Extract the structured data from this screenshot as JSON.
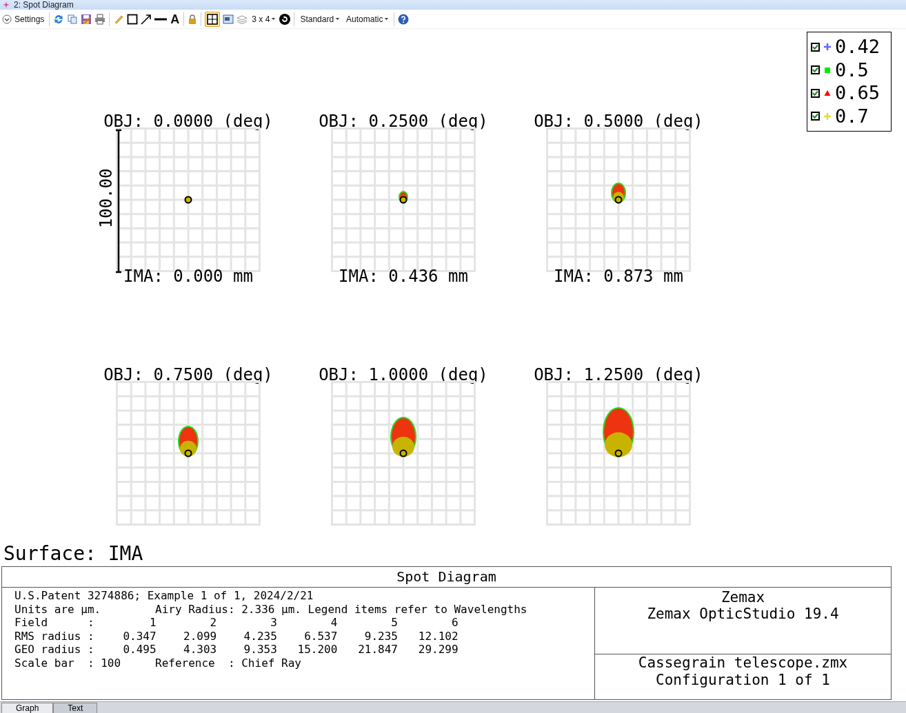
{
  "window": {
    "title": "2: Spot Diagram"
  },
  "toolbar": {
    "settings_label": "Settings",
    "text_tool": "A",
    "layout_selected": true,
    "grid_menu": "3 x 4",
    "standard_menu": "Standard",
    "automatic_menu": "Automatic"
  },
  "legend": [
    {
      "label": "0.42",
      "checked": true,
      "kind": "plus",
      "color": "#6666ff"
    },
    {
      "label": "0.5",
      "checked": true,
      "kind": "square",
      "color": "#00ee00"
    },
    {
      "label": "0.65",
      "checked": true,
      "kind": "triangle",
      "color": "#ff0000"
    },
    {
      "label": "0.7",
      "checked": true,
      "kind": "plus",
      "color": "#dddd44"
    }
  ],
  "plots": [
    {
      "title": "OBJ: 0.0000 (deg)",
      "image_label": "IMA: 0.000 mm",
      "scale_bar": "100.00"
    },
    {
      "title": "OBJ: 0.2500 (deg)",
      "image_label": "IMA: 0.436 mm"
    },
    {
      "title": "OBJ: 0.5000 (deg)",
      "image_label": "IMA: 0.873 mm"
    },
    {
      "title": "OBJ: 0.7500 (deg)"
    },
    {
      "title": "OBJ: 1.0000 (deg)"
    },
    {
      "title": "OBJ: 1.2500 (deg)"
    }
  ],
  "surface_label": "Surface: IMA",
  "info": {
    "title": "Spot Diagram",
    "header": "U.S.Patent 3274886; Example 1 of 1, 2024/2/21",
    "units": "Units are µm.",
    "airy": "Airy Radius: 2.336 µm. Legend items refer to Wavelengths",
    "rows": [
      {
        "label": "Field      :",
        "values": [
          "1",
          "2",
          "3",
          "4",
          "5",
          "6"
        ]
      },
      {
        "label": "RMS radius :",
        "values": [
          "0.347",
          "2.099",
          "4.235",
          "6.537",
          "9.235",
          "12.102"
        ]
      },
      {
        "label": "GEO radius :",
        "values": [
          "0.495",
          "4.303",
          "9.353",
          "15.200",
          "21.847",
          "29.299"
        ]
      }
    ],
    "scale_bar": "Scale bar  : 100",
    "reference": "Reference  : Chief Ray",
    "company": [
      "Zemax",
      "Zemax OpticStudio 19.4"
    ],
    "file": [
      "Cassegrain telescope.zmx",
      "Configuration 1 of 1"
    ]
  },
  "tabs": [
    {
      "label": "Graph",
      "selected": true
    },
    {
      "label": "Text",
      "selected": false
    }
  ]
}
